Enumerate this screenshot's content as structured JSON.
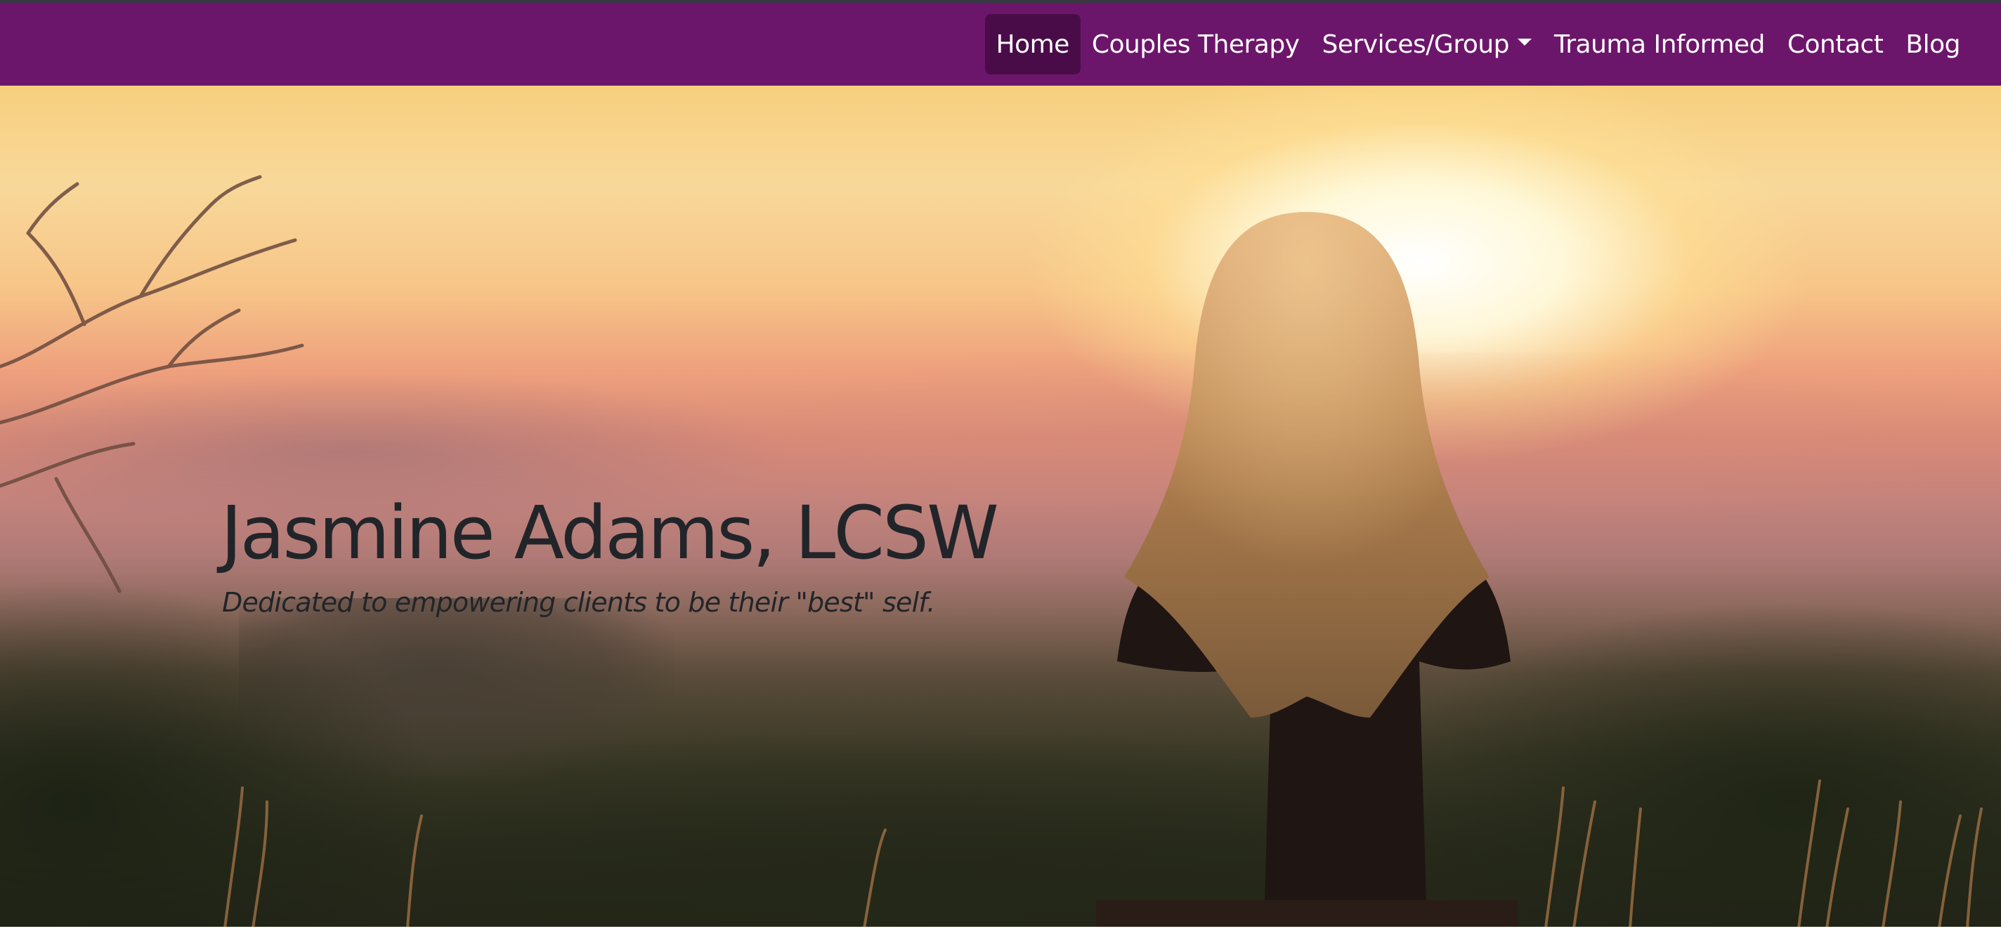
{
  "colors": {
    "navbar_bg": "#6c166b",
    "nav_active_bg": "#4a0c49",
    "nav_text": "#ffffff",
    "hero_text": "#212529"
  },
  "nav": {
    "items": [
      {
        "label": "Home",
        "active": true
      },
      {
        "label": "Couples Therapy"
      },
      {
        "label": "Services/Group",
        "dropdown": true
      },
      {
        "label": "Trauma Informed"
      },
      {
        "label": "Contact"
      },
      {
        "label": "Blog"
      }
    ]
  },
  "hero": {
    "title": "Jasmine Adams, LCSW",
    "subtitle": "Dedicated to empowering clients to be their \"best\" self."
  }
}
